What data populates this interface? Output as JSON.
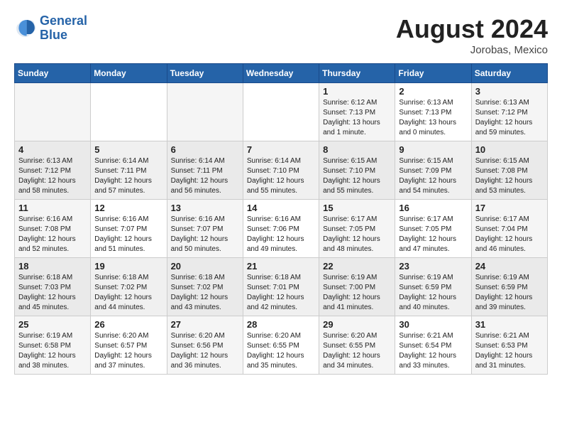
{
  "header": {
    "logo_line1": "General",
    "logo_line2": "Blue",
    "month_title": "August 2024",
    "subtitle": "Jorobas, Mexico"
  },
  "days_of_week": [
    "Sunday",
    "Monday",
    "Tuesday",
    "Wednesday",
    "Thursday",
    "Friday",
    "Saturday"
  ],
  "weeks": [
    [
      {
        "day": "",
        "info": ""
      },
      {
        "day": "",
        "info": ""
      },
      {
        "day": "",
        "info": ""
      },
      {
        "day": "",
        "info": ""
      },
      {
        "day": "1",
        "info": "Sunrise: 6:12 AM\nSunset: 7:13 PM\nDaylight: 13 hours\nand 1 minute."
      },
      {
        "day": "2",
        "info": "Sunrise: 6:13 AM\nSunset: 7:13 PM\nDaylight: 13 hours\nand 0 minutes."
      },
      {
        "day": "3",
        "info": "Sunrise: 6:13 AM\nSunset: 7:12 PM\nDaylight: 12 hours\nand 59 minutes."
      }
    ],
    [
      {
        "day": "4",
        "info": "Sunrise: 6:13 AM\nSunset: 7:12 PM\nDaylight: 12 hours\nand 58 minutes."
      },
      {
        "day": "5",
        "info": "Sunrise: 6:14 AM\nSunset: 7:11 PM\nDaylight: 12 hours\nand 57 minutes."
      },
      {
        "day": "6",
        "info": "Sunrise: 6:14 AM\nSunset: 7:11 PM\nDaylight: 12 hours\nand 56 minutes."
      },
      {
        "day": "7",
        "info": "Sunrise: 6:14 AM\nSunset: 7:10 PM\nDaylight: 12 hours\nand 55 minutes."
      },
      {
        "day": "8",
        "info": "Sunrise: 6:15 AM\nSunset: 7:10 PM\nDaylight: 12 hours\nand 55 minutes."
      },
      {
        "day": "9",
        "info": "Sunrise: 6:15 AM\nSunset: 7:09 PM\nDaylight: 12 hours\nand 54 minutes."
      },
      {
        "day": "10",
        "info": "Sunrise: 6:15 AM\nSunset: 7:08 PM\nDaylight: 12 hours\nand 53 minutes."
      }
    ],
    [
      {
        "day": "11",
        "info": "Sunrise: 6:16 AM\nSunset: 7:08 PM\nDaylight: 12 hours\nand 52 minutes."
      },
      {
        "day": "12",
        "info": "Sunrise: 6:16 AM\nSunset: 7:07 PM\nDaylight: 12 hours\nand 51 minutes."
      },
      {
        "day": "13",
        "info": "Sunrise: 6:16 AM\nSunset: 7:07 PM\nDaylight: 12 hours\nand 50 minutes."
      },
      {
        "day": "14",
        "info": "Sunrise: 6:16 AM\nSunset: 7:06 PM\nDaylight: 12 hours\nand 49 minutes."
      },
      {
        "day": "15",
        "info": "Sunrise: 6:17 AM\nSunset: 7:05 PM\nDaylight: 12 hours\nand 48 minutes."
      },
      {
        "day": "16",
        "info": "Sunrise: 6:17 AM\nSunset: 7:05 PM\nDaylight: 12 hours\nand 47 minutes."
      },
      {
        "day": "17",
        "info": "Sunrise: 6:17 AM\nSunset: 7:04 PM\nDaylight: 12 hours\nand 46 minutes."
      }
    ],
    [
      {
        "day": "18",
        "info": "Sunrise: 6:18 AM\nSunset: 7:03 PM\nDaylight: 12 hours\nand 45 minutes."
      },
      {
        "day": "19",
        "info": "Sunrise: 6:18 AM\nSunset: 7:02 PM\nDaylight: 12 hours\nand 44 minutes."
      },
      {
        "day": "20",
        "info": "Sunrise: 6:18 AM\nSunset: 7:02 PM\nDaylight: 12 hours\nand 43 minutes."
      },
      {
        "day": "21",
        "info": "Sunrise: 6:18 AM\nSunset: 7:01 PM\nDaylight: 12 hours\nand 42 minutes."
      },
      {
        "day": "22",
        "info": "Sunrise: 6:19 AM\nSunset: 7:00 PM\nDaylight: 12 hours\nand 41 minutes."
      },
      {
        "day": "23",
        "info": "Sunrise: 6:19 AM\nSunset: 6:59 PM\nDaylight: 12 hours\nand 40 minutes."
      },
      {
        "day": "24",
        "info": "Sunrise: 6:19 AM\nSunset: 6:59 PM\nDaylight: 12 hours\nand 39 minutes."
      }
    ],
    [
      {
        "day": "25",
        "info": "Sunrise: 6:19 AM\nSunset: 6:58 PM\nDaylight: 12 hours\nand 38 minutes."
      },
      {
        "day": "26",
        "info": "Sunrise: 6:20 AM\nSunset: 6:57 PM\nDaylight: 12 hours\nand 37 minutes."
      },
      {
        "day": "27",
        "info": "Sunrise: 6:20 AM\nSunset: 6:56 PM\nDaylight: 12 hours\nand 36 minutes."
      },
      {
        "day": "28",
        "info": "Sunrise: 6:20 AM\nSunset: 6:55 PM\nDaylight: 12 hours\nand 35 minutes."
      },
      {
        "day": "29",
        "info": "Sunrise: 6:20 AM\nSunset: 6:55 PM\nDaylight: 12 hours\nand 34 minutes."
      },
      {
        "day": "30",
        "info": "Sunrise: 6:21 AM\nSunset: 6:54 PM\nDaylight: 12 hours\nand 33 minutes."
      },
      {
        "day": "31",
        "info": "Sunrise: 6:21 AM\nSunset: 6:53 PM\nDaylight: 12 hours\nand 31 minutes."
      }
    ]
  ]
}
